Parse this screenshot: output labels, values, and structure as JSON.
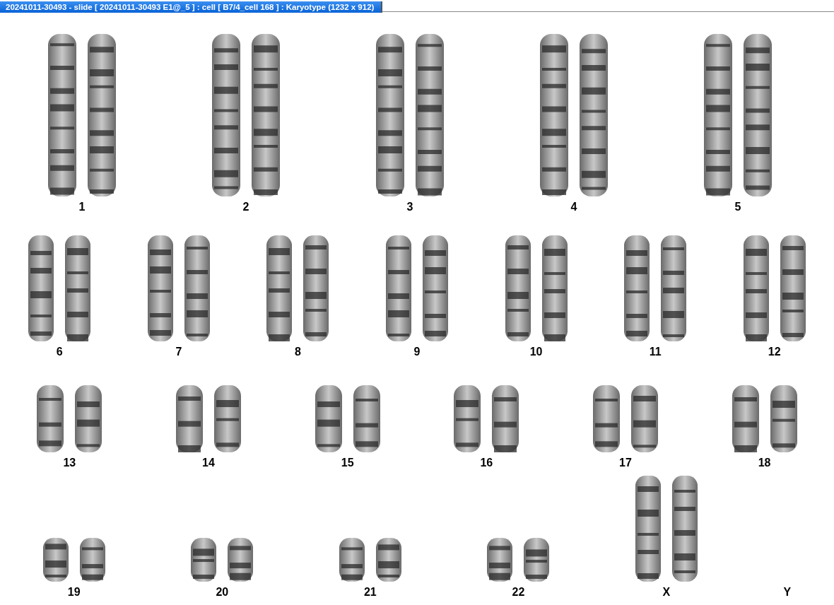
{
  "window": {
    "title": "20241011-30493 - slide [ 20241011-30493 E1@_5 ] : cell [ B7/4_cell 168 ] : Karyotype  (1232 x 912)"
  },
  "karyotype": {
    "rows": [
      [
        {
          "label": "1",
          "kind": "long"
        },
        {
          "label": "2",
          "kind": "long"
        },
        {
          "label": "3",
          "kind": "long"
        },
        {
          "label": "4",
          "kind": "long"
        },
        {
          "label": "5",
          "kind": "long"
        }
      ],
      [
        {
          "label": "6",
          "kind": "medium"
        },
        {
          "label": "7",
          "kind": "medium"
        },
        {
          "label": "8",
          "kind": "medium"
        },
        {
          "label": "9",
          "kind": "medium"
        },
        {
          "label": "10",
          "kind": "medium"
        },
        {
          "label": "11",
          "kind": "medium"
        },
        {
          "label": "12",
          "kind": "medium"
        }
      ],
      [
        {
          "label": "13",
          "kind": "short"
        },
        {
          "label": "14",
          "kind": "short"
        },
        {
          "label": "15",
          "kind": "short"
        },
        {
          "label": "16",
          "kind": "short"
        },
        {
          "label": "17",
          "kind": "short"
        },
        {
          "label": "18",
          "kind": "short"
        }
      ],
      [
        {
          "label": "19",
          "kind": "tiny"
        },
        {
          "label": "20",
          "kind": "tiny"
        },
        {
          "label": "21",
          "kind": "tiny"
        },
        {
          "label": "22",
          "kind": "tiny"
        },
        {
          "label": "X",
          "kind": "medium"
        },
        {
          "label": "Y",
          "kind": "none"
        }
      ]
    ]
  }
}
